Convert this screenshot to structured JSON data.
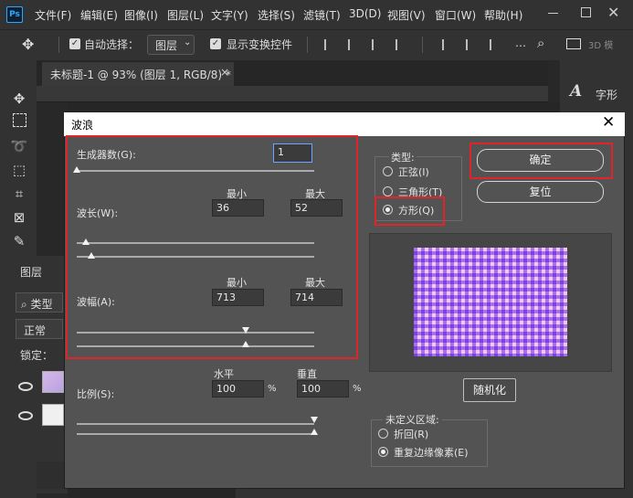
{
  "app": {
    "logo": "Ps",
    "menu": [
      "文件(F)",
      "编辑(E)",
      "图像(I)",
      "图层(L)",
      "文字(Y)",
      "选择(S)",
      "滤镜(T)",
      "3D(D)",
      "视图(V)",
      "窗口(W)",
      "帮助(H)"
    ]
  },
  "options_bar": {
    "auto_select_label": "自动选择：",
    "layer_select_value": "图层",
    "show_transform_label": "显示变换控件",
    "mode_3d_label": "3D 模"
  },
  "document": {
    "tab_title": "未标题-1 @ 93% (图层 1, RGB/8) *",
    "tab_close": "×"
  },
  "right_panel": {
    "character_label": "字形"
  },
  "layers_panel": {
    "tab_label": "图层",
    "search_label": "类型",
    "blend_mode": "正常",
    "lock_label": "锁定："
  },
  "dialog": {
    "title": "波浪",
    "generators_label": "生成器数(G):",
    "generators_value": "1",
    "min_label": "最小",
    "max_label": "最大",
    "wavelength_label": "波长(W):",
    "wavelength_min": "36",
    "wavelength_max": "52",
    "amplitude_label": "波幅(A):",
    "amplitude_min": "713",
    "amplitude_max": "714",
    "scale_label": "比例(S):",
    "horizontal_label": "水平",
    "vertical_label": "垂直",
    "scale_horizontal": "100",
    "scale_vertical": "100",
    "percent": "%",
    "type_group_label": "类型:",
    "type_options": [
      "正弦(I)",
      "三角形(T)",
      "方形(Q)"
    ],
    "type_selected": "方形(Q)",
    "ok_label": "确定",
    "reset_label": "复位",
    "randomize_label": "随机化",
    "undefined_area_label": "未定义区域:",
    "undefined_options": [
      "折回(R)",
      "重复边缘像素(E)"
    ],
    "undefined_selected": "重复边缘像素(E)",
    "sliders": {
      "generators": 0.0,
      "wavelength_min": 0.04,
      "wavelength_max": 0.06,
      "amplitude_min": 0.71,
      "amplitude_max": 0.71,
      "scale_horizontal": 1.0,
      "scale_vertical": 1.0
    },
    "preview_colors": {
      "pink": "#f4c6ea",
      "lavender": "#a580ff"
    },
    "highlight_color": "#e0242b"
  }
}
